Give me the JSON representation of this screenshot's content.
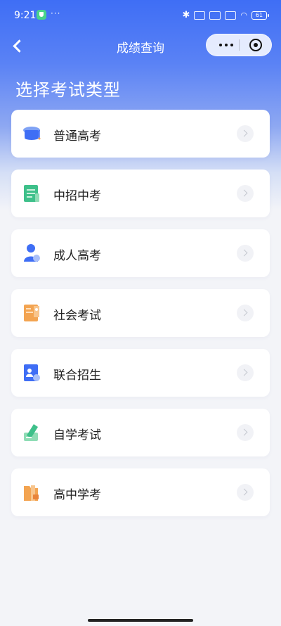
{
  "status_bar": {
    "time": "9:21",
    "dots": "···",
    "battery": "61"
  },
  "navbar": {
    "title": "成绩查询"
  },
  "heading": "选择考试类型",
  "items": [
    {
      "label": "普通高考",
      "icon": "graduation-cap-icon"
    },
    {
      "label": "中招中考",
      "icon": "book-icon"
    },
    {
      "label": "成人高考",
      "icon": "person-icon"
    },
    {
      "label": "社会考试",
      "icon": "document-icon"
    },
    {
      "label": "联合招生",
      "icon": "id-card-icon"
    },
    {
      "label": "自学考试",
      "icon": "pencil-note-icon"
    },
    {
      "label": "高中学考",
      "icon": "folder-lock-icon"
    }
  ],
  "colors": {
    "header_blue": "#3f6ef5",
    "page_bg": "#f3f4f8",
    "icon_blue": "#4a7cf0",
    "icon_green": "#3ec08a",
    "icon_orange": "#f3a451"
  }
}
